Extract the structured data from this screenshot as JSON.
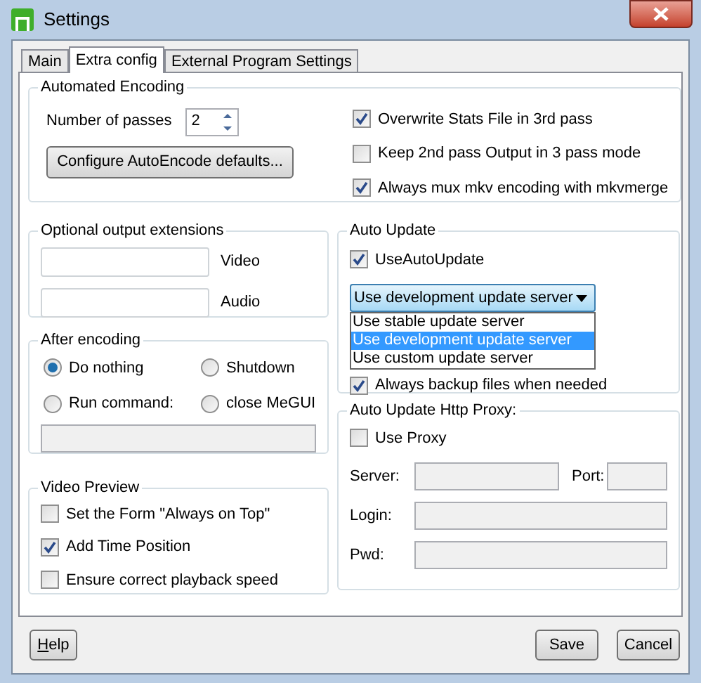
{
  "window": {
    "title": "Settings"
  },
  "tabs": [
    {
      "label": "Main",
      "selected": false
    },
    {
      "label": "Extra config",
      "selected": true
    },
    {
      "label": "External Program Settings",
      "selected": false
    }
  ],
  "automated_encoding": {
    "title": "Automated Encoding",
    "passes_label": "Number of passes",
    "passes_value": "2",
    "configure_button": "Configure AutoEncode defaults...",
    "options": [
      {
        "label": "Overwrite Stats File in 3rd pass",
        "checked": true
      },
      {
        "label": "Keep 2nd pass Output in 3 pass mode",
        "checked": false
      },
      {
        "label": "Always mux mkv encoding with mkvmerge",
        "checked": true
      }
    ]
  },
  "output_extensions": {
    "title": "Optional output extensions",
    "fields": [
      {
        "label": "Video"
      },
      {
        "label": "Audio"
      }
    ]
  },
  "after_encoding": {
    "title": "After encoding",
    "options": [
      {
        "label": "Do nothing",
        "selected": true
      },
      {
        "label": "Shutdown",
        "selected": false
      },
      {
        "label": "Run command:",
        "selected": false
      },
      {
        "label": "close MeGUI",
        "selected": false
      }
    ],
    "command_field": {
      "disabled": true
    }
  },
  "video_preview": {
    "title": "Video Preview",
    "options": [
      {
        "label": "Set the Form \"Always on Top\"",
        "checked": false
      },
      {
        "label": "Add Time Position",
        "checked": true
      },
      {
        "label": "Ensure correct playback speed",
        "checked": false
      }
    ]
  },
  "auto_update": {
    "title": "Auto Update",
    "use_auto_update": {
      "label": "UseAutoUpdate",
      "checked": true
    },
    "dropdown": {
      "value": "Use development update server",
      "expanded": true,
      "options": [
        {
          "label": "Use stable update server",
          "selected": false
        },
        {
          "label": "Use development update server",
          "selected": true
        },
        {
          "label": "Use custom update server",
          "selected": false
        }
      ]
    },
    "backup": {
      "label": "Always backup files when needed",
      "checked": true
    }
  },
  "proxy": {
    "title": "Auto Update Http Proxy:",
    "use_proxy": {
      "label": "Use Proxy",
      "checked": false
    },
    "fields": [
      {
        "label": "Server:",
        "disabled": true
      },
      {
        "label": "Port:",
        "disabled": true
      },
      {
        "label": "Login:",
        "disabled": true
      },
      {
        "label": "Pwd:",
        "disabled": true
      }
    ]
  },
  "buttons": [
    {
      "label": "Help",
      "mnemonic_underlined": true
    },
    {
      "label": "Save",
      "mnemonic_underlined": false
    },
    {
      "label": "Cancel",
      "mnemonic_underlined": false
    }
  ]
}
